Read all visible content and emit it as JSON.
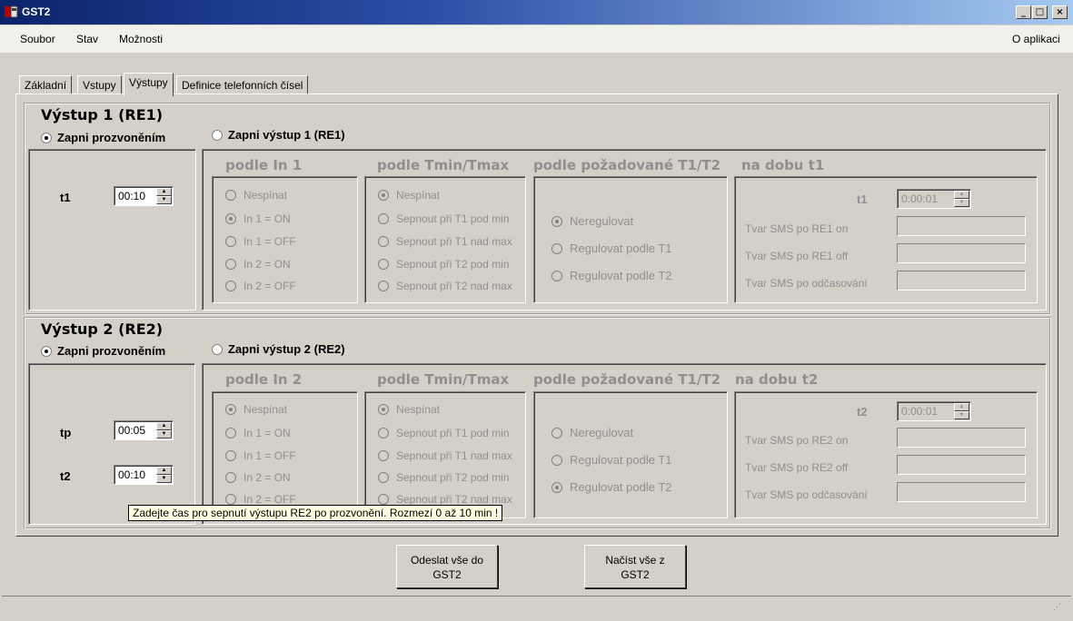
{
  "window": {
    "title": "GST2",
    "controls": {
      "minimize": "_",
      "maximize": "□",
      "close": "×"
    }
  },
  "menu": {
    "items": [
      "Soubor",
      "Stav",
      "Možnosti"
    ],
    "right_item": "O aplikaci"
  },
  "tabs": [
    {
      "label": "Základní",
      "active": false
    },
    {
      "label": "Vstupy",
      "active": false
    },
    {
      "label": "Výstupy",
      "active": true
    },
    {
      "label": "Definice telefonních čísel",
      "active": false
    }
  ],
  "outputs": [
    {
      "title": "Výstup 1 (RE1)",
      "mode_options": [
        {
          "label": "Zapni prozvoněním",
          "selected": true
        },
        {
          "label": "Zapni výstup 1 (RE1)",
          "selected": false
        }
      ],
      "time_fields": [
        {
          "label": "t1",
          "value": "00:10"
        }
      ],
      "inputs_group": {
        "header": "podle In 1",
        "options": [
          {
            "label": "Nespínat",
            "selected": false
          },
          {
            "label": "In 1 = ON",
            "selected": true
          },
          {
            "label": "In 1 = OFF",
            "selected": false
          },
          {
            "label": "In 2 = ON",
            "selected": false
          },
          {
            "label": "In 2 = OFF",
            "selected": false
          }
        ]
      },
      "tminmax_group": {
        "header": "podle Tmin/Tmax",
        "options": [
          {
            "label": "Nespínat",
            "selected": true
          },
          {
            "label": "Sepnout při T1 pod min",
            "selected": false
          },
          {
            "label": "Sepnout při T1 nad max",
            "selected": false
          },
          {
            "label": "Sepnout při T2 pod min",
            "selected": false
          },
          {
            "label": "Sepnout při T2 nad max",
            "selected": false
          }
        ]
      },
      "regulation_group": {
        "header": "podle požadované T1/T2",
        "options": [
          {
            "label": "Neregulovat",
            "selected": true
          },
          {
            "label": "Regulovat podle T1",
            "selected": false
          },
          {
            "label": "Regulovat podle T2",
            "selected": false
          }
        ]
      },
      "duration_group": {
        "header": "na dobu t1",
        "time_label": "t1",
        "time_value": "0:00:01",
        "sms_fields": [
          {
            "label": "Tvar SMS po RE1 on",
            "value": ""
          },
          {
            "label": "Tvar SMS po RE1 off",
            "value": ""
          },
          {
            "label": "Tvar SMS po odčasování",
            "value": ""
          }
        ]
      }
    },
    {
      "title": "Výstup 2 (RE2)",
      "mode_options": [
        {
          "label": "Zapni prozvoněním",
          "selected": true
        },
        {
          "label": "Zapni výstup 2 (RE2)",
          "selected": false
        }
      ],
      "time_fields": [
        {
          "label": "tp",
          "value": "00:05"
        },
        {
          "label": "t2",
          "value": "00:10"
        }
      ],
      "inputs_group": {
        "header": "podle In 2",
        "options": [
          {
            "label": "Nespínat",
            "selected": true
          },
          {
            "label": "In 1 = ON",
            "selected": false
          },
          {
            "label": "In 1 = OFF",
            "selected": false
          },
          {
            "label": "In 2 = ON",
            "selected": false
          },
          {
            "label": "In 2 = OFF",
            "selected": false
          }
        ]
      },
      "tminmax_group": {
        "header": "podle Tmin/Tmax",
        "options": [
          {
            "label": "Nespínat",
            "selected": true
          },
          {
            "label": "Sepnout při T1 pod min",
            "selected": false
          },
          {
            "label": "Sepnout při T1 nad max",
            "selected": false
          },
          {
            "label": "Sepnout při T2 pod min",
            "selected": false
          },
          {
            "label": "Sepnout při T2 nad max",
            "selected": false
          }
        ]
      },
      "regulation_group": {
        "header": "podle požadované T1/T2",
        "options": [
          {
            "label": "Neregulovat",
            "selected": false
          },
          {
            "label": "Regulovat podle T1",
            "selected": false
          },
          {
            "label": "Regulovat podle T2",
            "selected": true
          }
        ]
      },
      "duration_group": {
        "header": "na dobu t2",
        "time_label": "t2",
        "time_value": "0:00:01",
        "sms_fields": [
          {
            "label": "Tvar SMS po RE2 on",
            "value": ""
          },
          {
            "label": "Tvar SMS po RE2 off",
            "value": ""
          },
          {
            "label": "Tvar SMS po odčasování",
            "value": ""
          }
        ]
      }
    }
  ],
  "tooltip": "Zadejte čas pro sepnutí výstupu RE2 po prozvonění. Rozmezí 0 až 10 min !",
  "buttons": {
    "send_line1": "Odeslat vše do",
    "send_line2": "GST2",
    "load_line1": "Načíst vše z",
    "load_line2": "GST2"
  },
  "colors": {
    "titlebar_start": "#0a246a",
    "titlebar_end": "#a6caf0",
    "face": "#d4d0c8",
    "disabled_text": "#8f8f8f",
    "tooltip_bg": "#ffffe1"
  }
}
